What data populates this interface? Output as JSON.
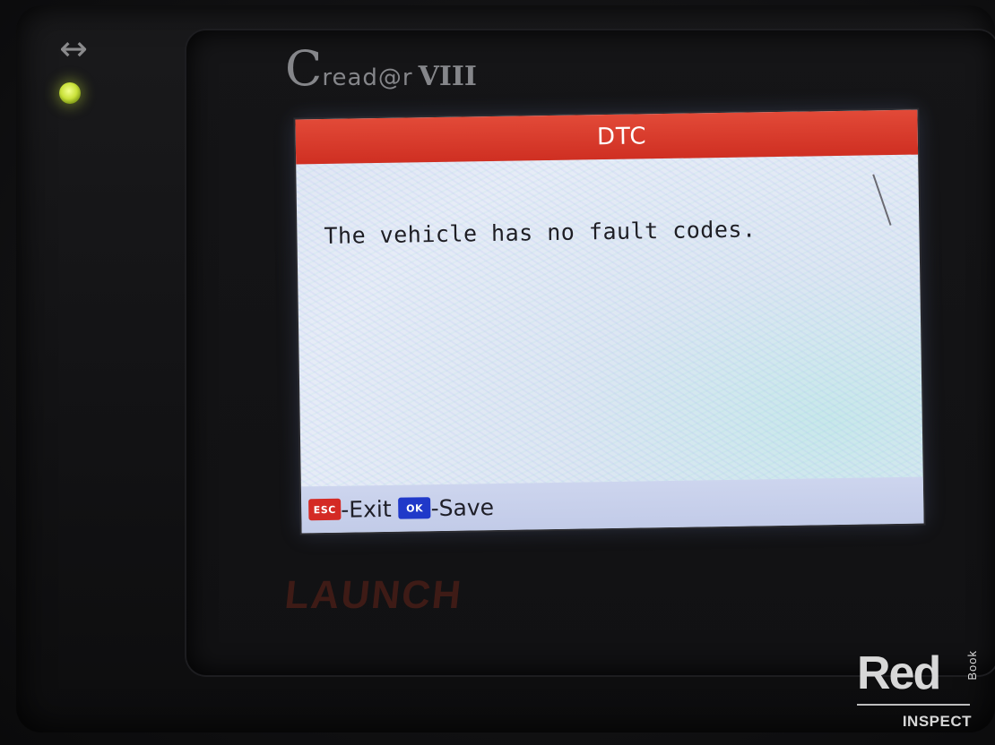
{
  "device": {
    "brand": {
      "c_letter": "C",
      "word": "read@r",
      "model": "VIII"
    },
    "manufacturer_logo": "LAUNCH",
    "indicators": {
      "arrow_glyph": "↔",
      "led_color": "#c9e13a"
    }
  },
  "screen": {
    "title": "DTC",
    "message": "The vehicle has no fault codes.",
    "footer": {
      "esc_key": "ESC",
      "esc_action": "-Exit",
      "ok_key": "OK",
      "ok_action": "-Save"
    },
    "colors": {
      "titlebar": "#d63a2c",
      "esc_key": "#d42a24",
      "ok_key": "#2039c9"
    }
  },
  "watermark": {
    "red": "Red",
    "book": "Book",
    "inspect": "INSPECT"
  }
}
